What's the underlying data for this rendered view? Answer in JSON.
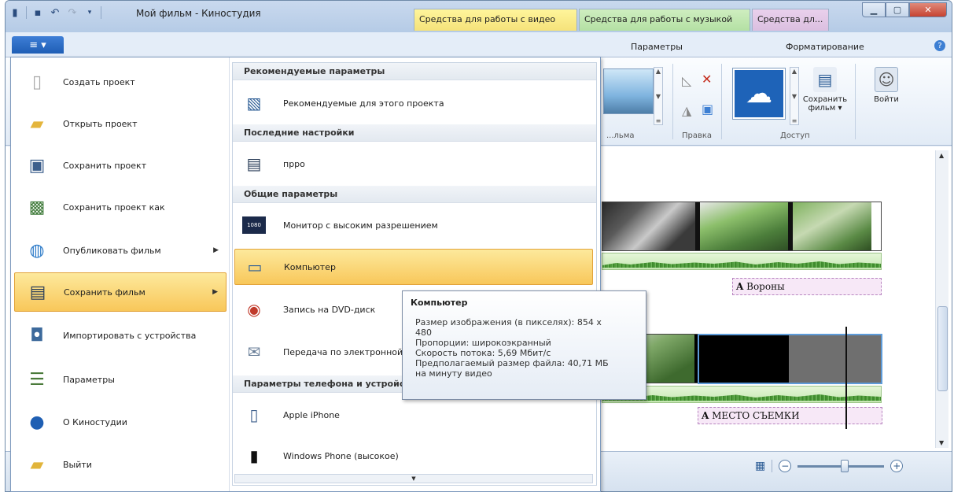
{
  "window": {
    "title": "Мой фильм - Киностудия",
    "context_tabs": [
      "Средства для работы с видео",
      "Средства для работы с музыкой",
      "Средства дл..."
    ],
    "controls": [
      "minimize-icon",
      "maximize-icon",
      "close-icon"
    ]
  },
  "ribbon": {
    "file_label": "≡ ▾",
    "tabs": [
      "Параметры",
      "Форматирование"
    ],
    "groups": [
      "...льма",
      "Правка",
      "Доступ"
    ],
    "save_movie_label": "Сохранить фильм ▾",
    "signin_label": "Войти"
  },
  "file_menu": {
    "items": [
      {
        "label": "Создать проект",
        "icon": "new-project-icon"
      },
      {
        "label": "Открыть проект",
        "icon": "open-folder-icon"
      },
      {
        "label": "Сохранить проект",
        "icon": "floppy-disk-icon"
      },
      {
        "label": "Сохранить проект как",
        "icon": "save-as-icon"
      },
      {
        "label": "Опубликовать фильм",
        "icon": "globe-icon",
        "submenu": true
      },
      {
        "label": "Сохранить фильм",
        "icon": "film-save-icon",
        "submenu": true,
        "active": true
      },
      {
        "label": "Импортировать с устройства",
        "icon": "camera-import-icon"
      },
      {
        "label": "Параметры",
        "icon": "options-icon"
      },
      {
        "label": "О Киностудии",
        "icon": "info-icon"
      },
      {
        "label": "Выйти",
        "icon": "exit-icon"
      }
    ],
    "submenu": {
      "sections": [
        {
          "title": "Рекомендуемые параметры",
          "items": [
            {
              "label": "Рекомендуемые для этого проекта"
            }
          ]
        },
        {
          "title": "Последние настройки",
          "items": [
            {
              "label": "пpро"
            }
          ]
        },
        {
          "title": "Общие параметры",
          "items": [
            {
              "label": "Монитор с высоким разрешением",
              "badge": "1080"
            },
            {
              "label": "Компьютер",
              "active": true
            },
            {
              "label": "Запись на DVD-диск"
            },
            {
              "label": "Передача по электронной почте"
            }
          ]
        },
        {
          "title": "Параметры телефона и устройства",
          "items": [
            {
              "label": "Apple iPhone"
            },
            {
              "label": "Windows Phone (высокое)"
            }
          ]
        }
      ]
    }
  },
  "tooltip": {
    "title": "Компьютер",
    "lines": [
      "Размер изображения (в пикселях): 854 x",
      "480",
      "Пропорции: широкоэкранный",
      "Скорость потока: 5,69 Мбит/с",
      "Предполагаемый размер файла: 40,71 МБ",
      "на минуту видео"
    ]
  },
  "timeline": {
    "captions": [
      "Вороны",
      "МЕСТО СЪЕМКИ"
    ],
    "caption_glyph": "A"
  }
}
